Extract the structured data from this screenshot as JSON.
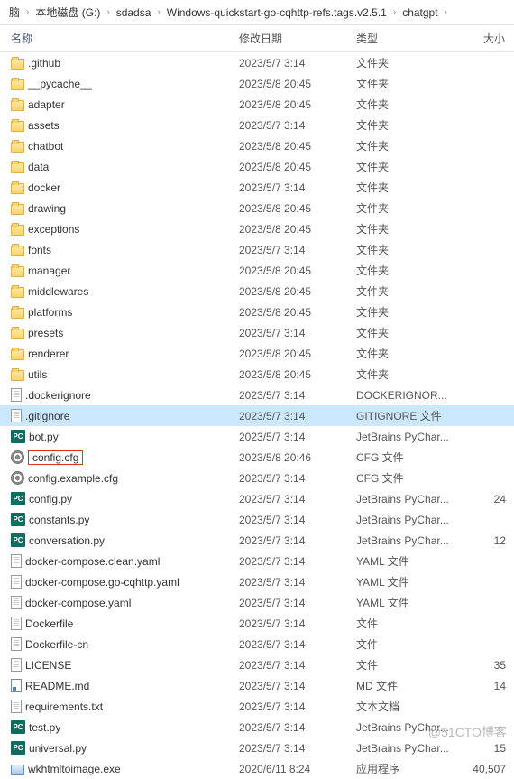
{
  "breadcrumb": [
    "脑",
    "本地磁盘 (G:)",
    "sdadsa",
    "Windows-quickstart-go-cqhttp-refs.tags.v2.5.1",
    "chatgpt"
  ],
  "headers": {
    "name": "名称",
    "date": "修改日期",
    "type": "类型",
    "size": "大小"
  },
  "watermark": "@51CTO博客",
  "files": [
    {
      "name": ".github",
      "date": "2023/5/7 3:14",
      "type": "文件夹",
      "size": "",
      "icon": "folder"
    },
    {
      "name": "__pycache__",
      "date": "2023/5/8 20:45",
      "type": "文件夹",
      "size": "",
      "icon": "folder"
    },
    {
      "name": "adapter",
      "date": "2023/5/8 20:45",
      "type": "文件夹",
      "size": "",
      "icon": "folder"
    },
    {
      "name": "assets",
      "date": "2023/5/7 3:14",
      "type": "文件夹",
      "size": "",
      "icon": "folder"
    },
    {
      "name": "chatbot",
      "date": "2023/5/8 20:45",
      "type": "文件夹",
      "size": "",
      "icon": "folder"
    },
    {
      "name": "data",
      "date": "2023/5/8 20:45",
      "type": "文件夹",
      "size": "",
      "icon": "folder"
    },
    {
      "name": "docker",
      "date": "2023/5/7 3:14",
      "type": "文件夹",
      "size": "",
      "icon": "folder"
    },
    {
      "name": "drawing",
      "date": "2023/5/8 20:45",
      "type": "文件夹",
      "size": "",
      "icon": "folder"
    },
    {
      "name": "exceptions",
      "date": "2023/5/8 20:45",
      "type": "文件夹",
      "size": "",
      "icon": "folder"
    },
    {
      "name": "fonts",
      "date": "2023/5/7 3:14",
      "type": "文件夹",
      "size": "",
      "icon": "folder"
    },
    {
      "name": "manager",
      "date": "2023/5/8 20:45",
      "type": "文件夹",
      "size": "",
      "icon": "folder"
    },
    {
      "name": "middlewares",
      "date": "2023/5/8 20:45",
      "type": "文件夹",
      "size": "",
      "icon": "folder"
    },
    {
      "name": "platforms",
      "date": "2023/5/8 20:45",
      "type": "文件夹",
      "size": "",
      "icon": "folder"
    },
    {
      "name": "presets",
      "date": "2023/5/7 3:14",
      "type": "文件夹",
      "size": "",
      "icon": "folder"
    },
    {
      "name": "renderer",
      "date": "2023/5/8 20:45",
      "type": "文件夹",
      "size": "",
      "icon": "folder"
    },
    {
      "name": "utils",
      "date": "2023/5/8 20:45",
      "type": "文件夹",
      "size": "",
      "icon": "folder"
    },
    {
      "name": ".dockerignore",
      "date": "2023/5/7 3:14",
      "type": "DOCKERIGNOR...",
      "size": "",
      "icon": "file"
    },
    {
      "name": ".gitignore",
      "date": "2023/5/7 3:14",
      "type": "GITIGNORE 文件",
      "size": "",
      "icon": "file",
      "selected": true
    },
    {
      "name": "bot.py",
      "date": "2023/5/7 3:14",
      "type": "JetBrains PyChar...",
      "size": "",
      "icon": "pc"
    },
    {
      "name": "config.cfg",
      "date": "2023/5/8 20:46",
      "type": "CFG 文件",
      "size": "",
      "icon": "gear",
      "highlighted": true
    },
    {
      "name": "config.example.cfg",
      "date": "2023/5/7 3:14",
      "type": "CFG 文件",
      "size": "",
      "icon": "gear"
    },
    {
      "name": "config.py",
      "date": "2023/5/7 3:14",
      "type": "JetBrains PyChar...",
      "size": "24",
      "icon": "pc"
    },
    {
      "name": "constants.py",
      "date": "2023/5/7 3:14",
      "type": "JetBrains PyChar...",
      "size": "",
      "icon": "pc"
    },
    {
      "name": "conversation.py",
      "date": "2023/5/7 3:14",
      "type": "JetBrains PyChar...",
      "size": "12",
      "icon": "pc"
    },
    {
      "name": "docker-compose.clean.yaml",
      "date": "2023/5/7 3:14",
      "type": "YAML 文件",
      "size": "",
      "icon": "file"
    },
    {
      "name": "docker-compose.go-cqhttp.yaml",
      "date": "2023/5/7 3:14",
      "type": "YAML 文件",
      "size": "",
      "icon": "file"
    },
    {
      "name": "docker-compose.yaml",
      "date": "2023/5/7 3:14",
      "type": "YAML 文件",
      "size": "",
      "icon": "file"
    },
    {
      "name": "Dockerfile",
      "date": "2023/5/7 3:14",
      "type": "文件",
      "size": "",
      "icon": "file"
    },
    {
      "name": "Dockerfile-cn",
      "date": "2023/5/7 3:14",
      "type": "文件",
      "size": "",
      "icon": "file"
    },
    {
      "name": "LICENSE",
      "date": "2023/5/7 3:14",
      "type": "文件",
      "size": "35",
      "icon": "file"
    },
    {
      "name": "README.md",
      "date": "2023/5/7 3:14",
      "type": "MD 文件",
      "size": "14",
      "icon": "md"
    },
    {
      "name": "requirements.txt",
      "date": "2023/5/7 3:14",
      "type": "文本文档",
      "size": "",
      "icon": "file"
    },
    {
      "name": "test.py",
      "date": "2023/5/7 3:14",
      "type": "JetBrains PyChar...",
      "size": "",
      "icon": "pc"
    },
    {
      "name": "universal.py",
      "date": "2023/5/7 3:14",
      "type": "JetBrains PyChar...",
      "size": "15",
      "icon": "pc"
    },
    {
      "name": "wkhtmltoimage.exe",
      "date": "2020/6/11 8:24",
      "type": "应用程序",
      "size": "40,507",
      "icon": "exe"
    }
  ]
}
